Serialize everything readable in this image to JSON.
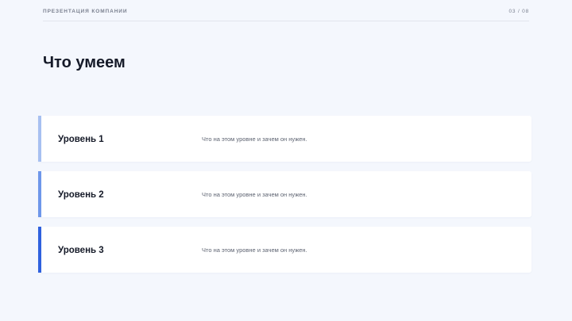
{
  "header": {
    "company": "Презентация компании",
    "page_counter": "03 / 08"
  },
  "title": "Что умеем",
  "levels": [
    {
      "title": "Уровень 1",
      "description": "Что на этом уровне и зачем он нужен.",
      "accent_color": "#a7c0f1"
    },
    {
      "title": "Уровень 2",
      "description": "Что на этом уровне и зачем он нужен.",
      "accent_color": "#6e97ea"
    },
    {
      "title": "Уровень 3",
      "description": "Что на этом уровне и зачем он нужен.",
      "accent_color": "#2f61de"
    }
  ],
  "colors": {
    "background": "#f4f7fd",
    "card": "#ffffff",
    "title_text": "#151a28",
    "muted_text": "#7b8190"
  }
}
